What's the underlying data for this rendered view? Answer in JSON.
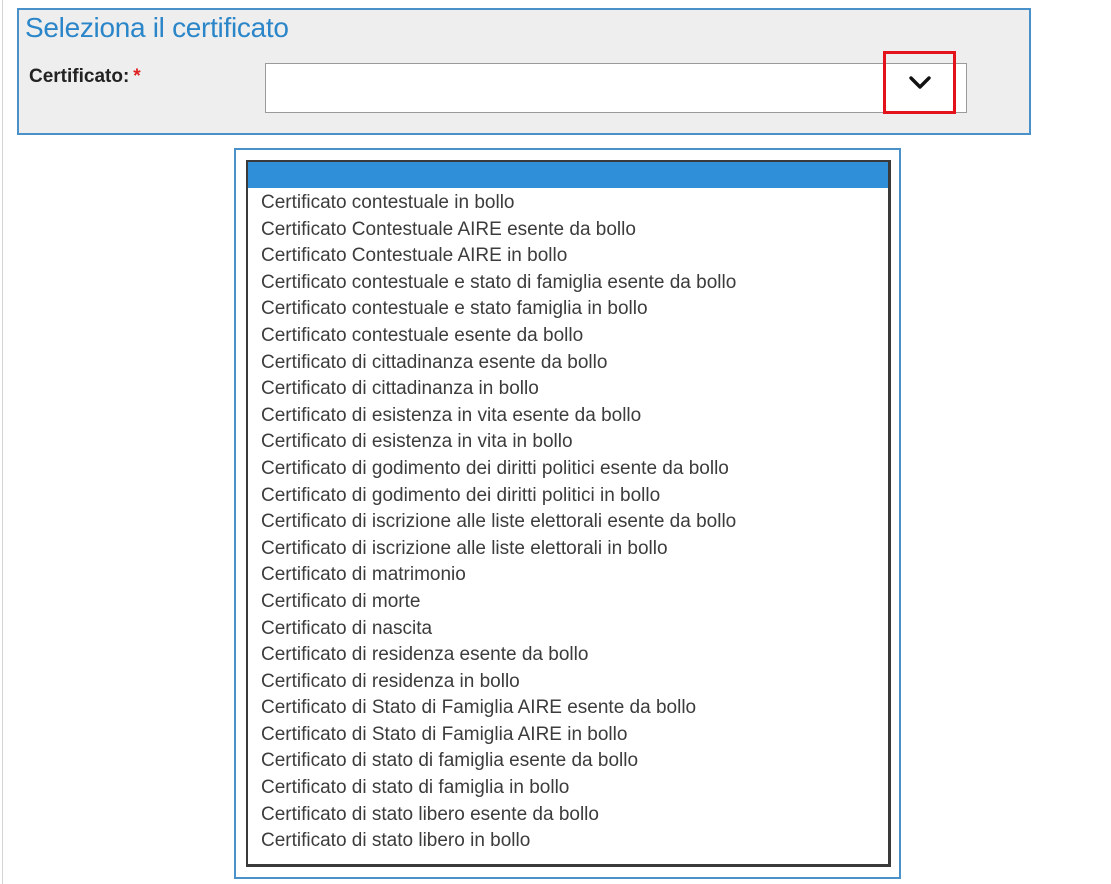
{
  "panel": {
    "title": "Seleziona il certificato",
    "field_label": "Certificato:",
    "required_marker": "*",
    "selected_value": "",
    "toggle_icon": "chevron-down-icon"
  },
  "dropdown": {
    "highlighted_option": "",
    "options": [
      "Certificato contestuale in bollo",
      "Certificato Contestuale AIRE esente da bollo",
      "Certificato Contestuale AIRE in bollo",
      "Certificato contestuale e stato di famiglia esente da bollo",
      "Certificato contestuale e stato famiglia in bollo",
      "Certificato contestuale esente da bollo",
      "Certificato di cittadinanza esente da bollo",
      "Certificato di cittadinanza in bollo",
      "Certificato di esistenza in vita esente da bollo",
      "Certificato di esistenza in vita in bollo",
      "Certificato di godimento dei diritti politici esente da bollo",
      "Certificato di godimento dei diritti politici in bollo",
      "Certificato di iscrizione alle liste elettorali esente da bollo",
      "Certificato di iscrizione alle liste elettorali in bollo",
      "Certificato di matrimonio",
      "Certificato di morte",
      "Certificato di nascita",
      "Certificato di residenza esente da bollo",
      "Certificato di residenza in bollo",
      "Certificato di Stato di Famiglia AIRE esente da bollo",
      "Certificato di Stato di Famiglia AIRE in bollo",
      "Certificato di stato di famiglia esente da bollo",
      "Certificato di stato di famiglia in bollo",
      "Certificato di stato libero esente da bollo",
      "Certificato di stato libero in bollo"
    ]
  },
  "colors": {
    "title_blue": "#2b86c9",
    "panel_border": "#4a90c9",
    "highlight_blue": "#2f8fd8",
    "required_red": "#e02020",
    "callout_red": "#e3121b"
  }
}
